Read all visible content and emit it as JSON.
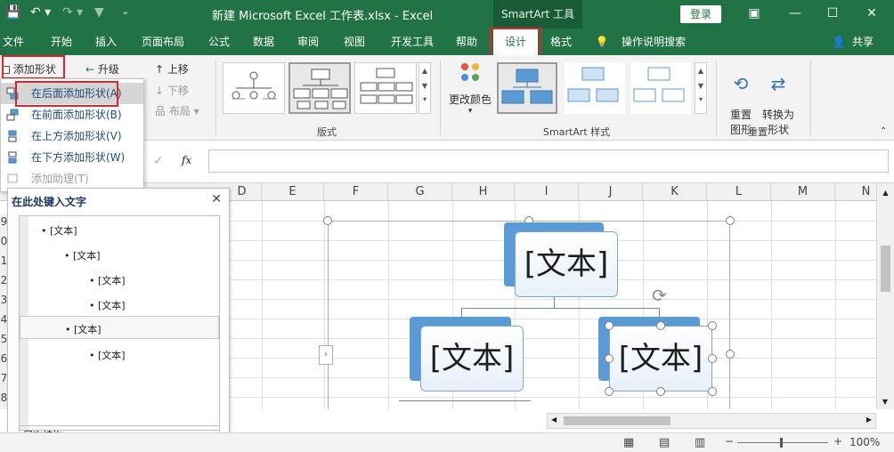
{
  "titlebar": {
    "title": "新建 Microsoft Excel 工作表.xlsx  -  Excel",
    "context_tab": "SmartArt 工具",
    "login": "登录"
  },
  "tabs": [
    "文件",
    "开始",
    "插入",
    "页面布局",
    "公式",
    "数据",
    "审阅",
    "视图",
    "开发工具",
    "帮助",
    "设计",
    "格式"
  ],
  "active_tab": "设计",
  "tell_me": "操作说明搜索",
  "share": "共享",
  "ribbon": {
    "add_shape": "添加形状",
    "promote": "升级",
    "move_up": "上移",
    "move_down": "下移",
    "layout_btn": "布局",
    "layouts_group": "版式",
    "change_colors": "更改颜色",
    "styles_group": "SmartArt 样式",
    "reset_graphic": "重置\n图形",
    "convert_shape": "转换为\n形状",
    "reset_group": "重置"
  },
  "menu": {
    "items": [
      {
        "label": "在后面添加形状(A)"
      },
      {
        "label": "在前面添加形状(B)"
      },
      {
        "label": "在上方添加形状(V)"
      },
      {
        "label": "在下方添加形状(W)"
      },
      {
        "label": "添加助理(T)"
      }
    ]
  },
  "formula_bar": {
    "fx": "fx",
    "check": "✓"
  },
  "columns": [
    "D",
    "E",
    "F",
    "G",
    "H",
    "I",
    "J",
    "K",
    "L",
    "M",
    "N"
  ],
  "rows": [
    "9",
    "0",
    "1",
    "2",
    "3",
    "4",
    "5",
    "6",
    "7",
    "8",
    "9"
  ],
  "text_pane": {
    "title": "在此处键入文字",
    "items": [
      "[文本]",
      "[文本]",
      "[文本]",
      "[文本]",
      "[文本]",
      "[文本]"
    ],
    "hierarchy": "层次结构..."
  },
  "smartart": {
    "top": "[文本]",
    "left": "[文本]",
    "right": "[文本]"
  },
  "status": {
    "zoom": "100%"
  },
  "colors": {
    "excel_green": "#217346",
    "highlight_red": "#d9262c",
    "shape_blue": "#5b9bd5"
  }
}
